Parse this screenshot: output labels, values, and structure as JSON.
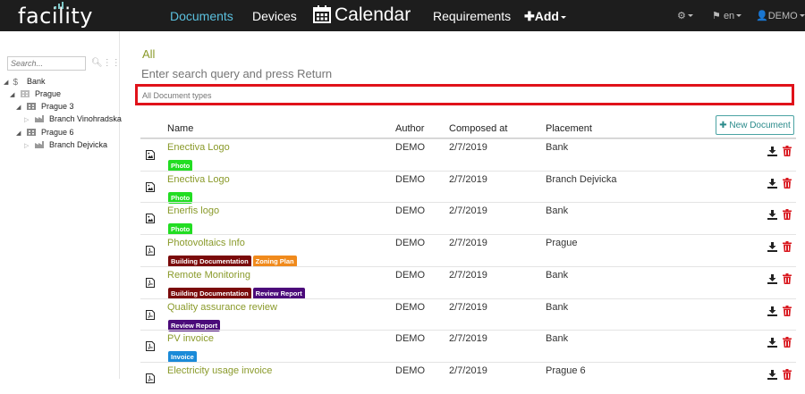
{
  "app": {
    "logo_text": "facility"
  },
  "nav": {
    "documents": "Documents",
    "devices": "Devices",
    "calendar": "Calendar",
    "requirements": "Requirements",
    "add": "Add",
    "language": "en",
    "user": "DEMO"
  },
  "sidebar": {
    "search_placeholder": "Search...",
    "tree": [
      {
        "label": "Bank",
        "icon": "dollar-icon"
      },
      {
        "label": "Prague",
        "icon": "building-icon"
      },
      {
        "label": "Prague 3",
        "icon": "building-icon"
      },
      {
        "label": "Branch Vinohradska",
        "icon": "factory-icon"
      },
      {
        "label": "Prague 6",
        "icon": "building-icon"
      },
      {
        "label": "Branch Dejvicka",
        "icon": "factory-icon"
      }
    ]
  },
  "main": {
    "filter_label": "All",
    "search_placeholder": "Enter search query and press Return",
    "doctypes_placeholder": "All Document types",
    "new_document_label": "New Document",
    "columns": {
      "name": "Name",
      "author": "Author",
      "composed": "Composed at",
      "placement": "Placement"
    }
  },
  "tag_colors": {
    "Photo": "#22dd22",
    "Building Documentation": "#7a0a0a",
    "Zoning Plan": "#f08a1c",
    "Review Report": "#4b0a7a",
    "Invoice": "#1a8ad8"
  },
  "documents": [
    {
      "name": "Enectiva Logo",
      "tags": [
        "Photo"
      ],
      "author": "DEMO",
      "composed": "2/7/2019",
      "placement": "Bank",
      "icon": "image-file-icon"
    },
    {
      "name": "Enectiva Logo",
      "tags": [
        "Photo"
      ],
      "author": "DEMO",
      "composed": "2/7/2019",
      "placement": "Branch Dejvicka",
      "icon": "image-file-icon"
    },
    {
      "name": "Enerfis logo",
      "tags": [
        "Photo"
      ],
      "author": "DEMO",
      "composed": "2/7/2019",
      "placement": "Bank",
      "icon": "image-file-icon"
    },
    {
      "name": "Photovoltaics Info",
      "tags": [
        "Building Documentation",
        "Zoning Plan"
      ],
      "author": "DEMO",
      "composed": "2/7/2019",
      "placement": "Prague",
      "icon": "pdf-file-icon"
    },
    {
      "name": "Remote Monitoring",
      "tags": [
        "Building Documentation",
        "Review Report"
      ],
      "author": "DEMO",
      "composed": "2/7/2019",
      "placement": "Bank",
      "icon": "pdf-file-icon"
    },
    {
      "name": "Quality assurance review",
      "tags": [
        "Review Report"
      ],
      "author": "DEMO",
      "composed": "2/7/2019",
      "placement": "Bank",
      "icon": "pdf-file-icon"
    },
    {
      "name": "PV invoice",
      "tags": [
        "Invoice"
      ],
      "author": "DEMO",
      "composed": "2/7/2019",
      "placement": "Bank",
      "icon": "pdf-file-icon"
    },
    {
      "name": "Electricity usage invoice",
      "tags": [],
      "author": "DEMO",
      "composed": "2/7/2019",
      "placement": "Prague 6",
      "icon": "pdf-file-icon"
    }
  ]
}
